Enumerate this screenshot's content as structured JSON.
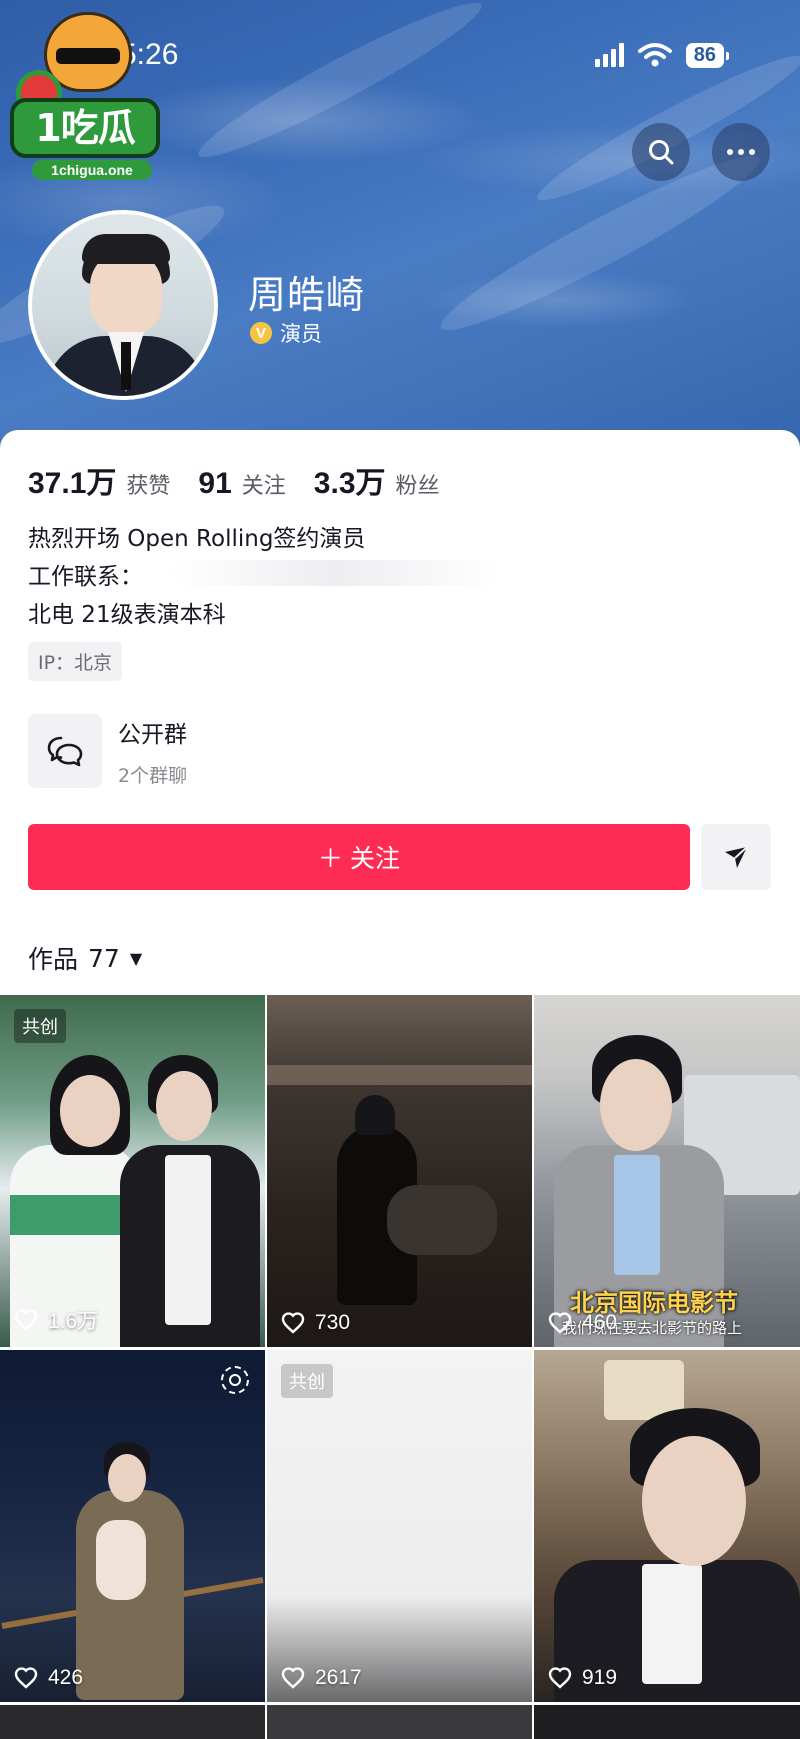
{
  "status_bar": {
    "time": "5:26",
    "battery": "86"
  },
  "watermark": {
    "brand": "1吃瓜",
    "url": "1chigua.one"
  },
  "profile": {
    "name": "周皓崎",
    "verify_badge": "V",
    "role": "演员"
  },
  "stats": [
    {
      "value": "37.1万",
      "label": "获赞"
    },
    {
      "value": "91",
      "label": "关注"
    },
    {
      "value": "3.3万",
      "label": "粉丝"
    }
  ],
  "bio": {
    "line1": "热烈开场 Open Rolling签约演员",
    "line2": "工作联系：",
    "line3": "北电 21级表演本科"
  },
  "ip": "IP：北京",
  "group": {
    "title": "公开群",
    "subtitle": "2个群聊"
  },
  "actions": {
    "follow_label": "＋ 关注"
  },
  "works": {
    "label": "作品",
    "count": "77"
  },
  "videos": [
    {
      "likes": "1.6万",
      "tag": "共创"
    },
    {
      "likes": "730"
    },
    {
      "likes": "460",
      "overlay_title": "北京国际电影节",
      "overlay_sub": "我们现在要去北影节的路上"
    },
    {
      "likes": "426"
    },
    {
      "likes": "2617",
      "tag": "共创"
    },
    {
      "likes": "919"
    }
  ],
  "icons": {
    "search": "search-icon",
    "more": "more-icon",
    "share": "share-icon",
    "group": "group-chat-icon",
    "heart": "heart-icon"
  },
  "colors": {
    "accent": "#fe2c55",
    "header_bg": "#3a6cb8",
    "verify": "#f5c443"
  }
}
